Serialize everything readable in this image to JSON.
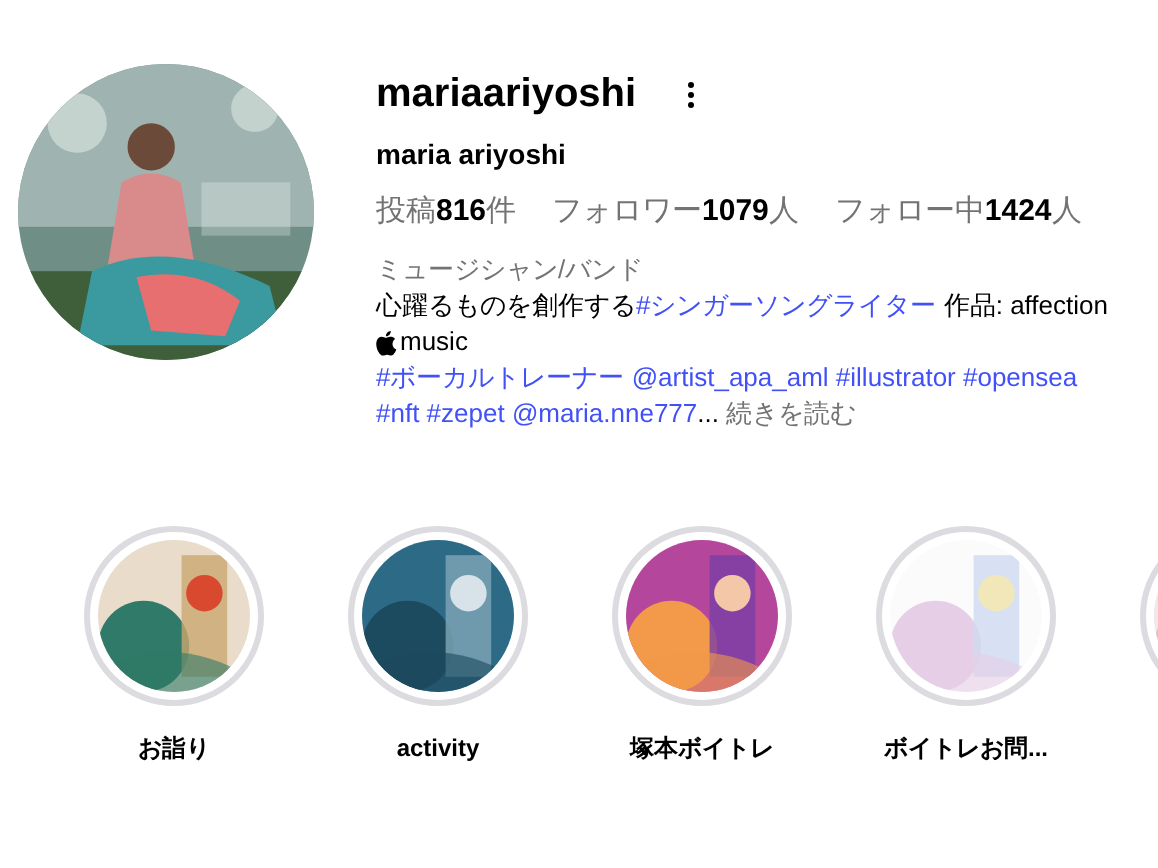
{
  "profile": {
    "username": "mariaariyoshi",
    "display_name": "maria ariyoshi",
    "stats": [
      {
        "label": "投稿",
        "count": "816",
        "unit": "件"
      },
      {
        "label": "フォロワー",
        "count": "1079",
        "unit": "人"
      },
      {
        "label": "フォロー中",
        "count": "1424",
        "unit": "人"
      }
    ],
    "category": "ミュージシャン/バンド",
    "bio_lines": [
      [
        {
          "kind": "plain",
          "text": "心躍るものを創作する"
        },
        {
          "kind": "link",
          "text": "#シンガーソングライター"
        },
        {
          "kind": "plain",
          "text": " 作品: affection"
        }
      ],
      [
        {
          "kind": "apple"
        },
        {
          "kind": "plain",
          "text": "music"
        }
      ],
      [
        {
          "kind": "link",
          "text": "#ボーカルトレーナー @artist_apa_aml #illustrator #opensea"
        }
      ],
      [
        {
          "kind": "link",
          "text": "#nft #zepet @maria.nne777"
        },
        {
          "kind": "plain",
          "text": "..."
        },
        {
          "kind": "more",
          "text": " 続きを読む"
        }
      ]
    ]
  },
  "highlights": [
    {
      "label": "お詣り",
      "kind": "picture"
    },
    {
      "label": "activity",
      "kind": "picture"
    },
    {
      "label": "塚本ボイトレ",
      "kind": "picture"
    },
    {
      "label": "ボイトレお問...",
      "kind": "picture"
    },
    {
      "kind": "picture"
    }
  ]
}
